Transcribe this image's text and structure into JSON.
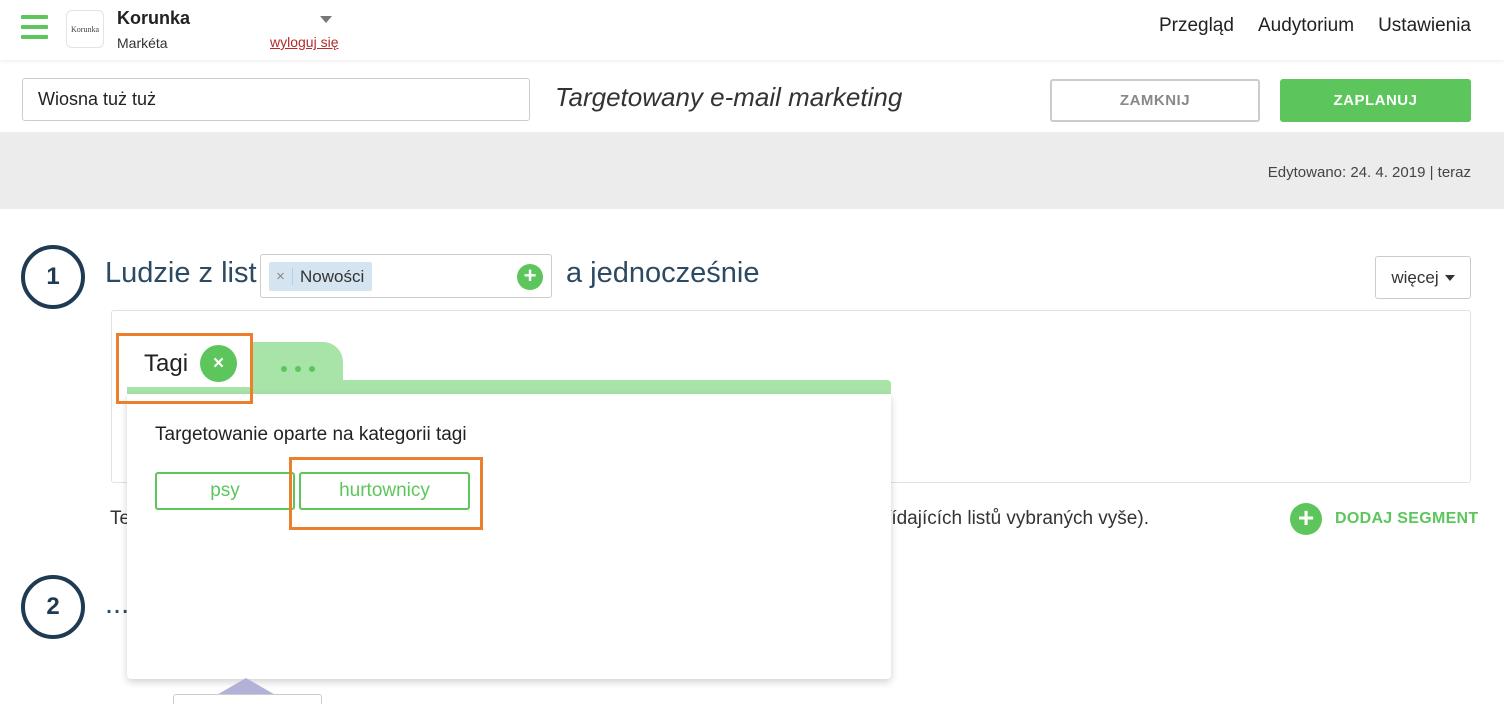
{
  "header": {
    "account_name": "Korunka",
    "logo_text": "Korunka",
    "user_name": "Markéta",
    "logout_label": "wyloguj się",
    "nav": [
      "Przegląd",
      "Audytorium",
      "Ustawienia"
    ]
  },
  "campaign": {
    "name_value": "Wiosna tuż tuż",
    "type_label": "Targetowany e-mail marketing",
    "close_label": "ZAMKNIJ",
    "schedule_label": "ZAPLANUJ",
    "edited": "Edytowano: 24. 4. 2019 | teraz"
  },
  "step1": {
    "number": "1",
    "label": "Ludzie z list",
    "selected_list": "Nowości",
    "remove_glyph": "×",
    "add_glyph": "+",
    "and_label": "a jednocześnie",
    "more_label": "więcej",
    "bottom_text_left": "Te",
    "bottom_text_right": "řídajících listů vybraných vyše).",
    "add_segment_glyph": "+",
    "add_segment_label": "DODAJ SEGMENT"
  },
  "step2": {
    "number": "2",
    "label": "..."
  },
  "tag_popup": {
    "tab_label": "Tagi",
    "tab_close_glyph": "×",
    "heading": "Targetowanie oparte na kategorii tagi",
    "tags": [
      "psy",
      "hurtownicy"
    ]
  },
  "colors": {
    "accent": "#5cc65c",
    "accent_light": "#a8e3a8",
    "step_navy": "#1f3a53",
    "highlight": "#ec7f2c",
    "logout": "#b22a2a"
  }
}
